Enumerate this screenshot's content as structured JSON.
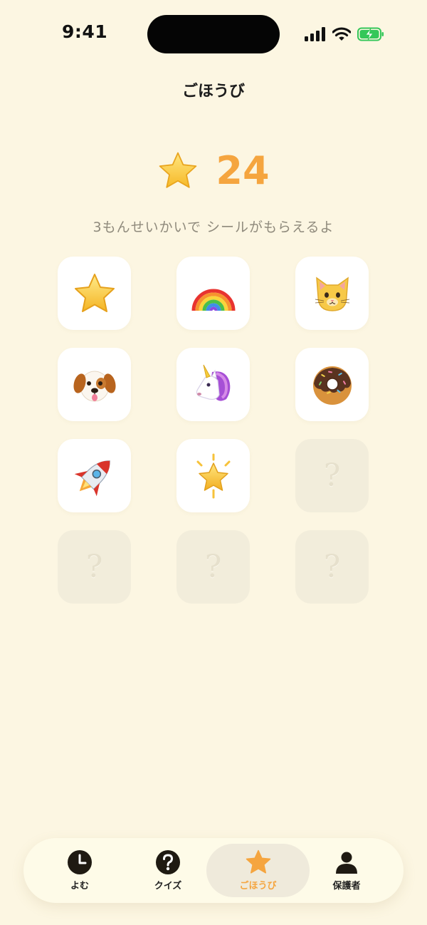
{
  "status_bar": {
    "time": "9:41"
  },
  "header": {
    "title": "ごほうび"
  },
  "score": {
    "icon": "star-icon",
    "value": "24"
  },
  "hint": "3もんせいかいで シールがもらえるよ",
  "stickers": [
    {
      "icon": "star-sticker",
      "earned": true
    },
    {
      "icon": "rainbow-sticker",
      "earned": true
    },
    {
      "icon": "cat-sticker",
      "earned": true
    },
    {
      "icon": "dog-sticker",
      "earned": true
    },
    {
      "icon": "unicorn-sticker",
      "earned": true
    },
    {
      "icon": "donut-sticker",
      "earned": true
    },
    {
      "icon": "rocket-sticker",
      "earned": true
    },
    {
      "icon": "glowing-star-sticker",
      "earned": true
    },
    {
      "icon": "locked-sticker",
      "earned": false,
      "label": "?"
    },
    {
      "icon": "locked-sticker",
      "earned": false,
      "label": "?"
    },
    {
      "icon": "locked-sticker",
      "earned": false,
      "label": "?"
    },
    {
      "icon": "locked-sticker",
      "earned": false,
      "label": "?"
    }
  ],
  "tab_bar": {
    "tabs": [
      {
        "label": "よむ",
        "icon": "clock-icon",
        "active": false
      },
      {
        "label": "クイズ",
        "icon": "question-icon",
        "active": false
      },
      {
        "label": "ごほうび",
        "icon": "star-icon",
        "active": true
      },
      {
        "label": "保護者",
        "icon": "person-icon",
        "active": false
      }
    ]
  },
  "colors": {
    "background": "#fcf6e2",
    "accent": "#f5a53f",
    "hint_text": "#8f8a7c",
    "locked_tile": "#f2eddb",
    "battery": "#34c759"
  }
}
